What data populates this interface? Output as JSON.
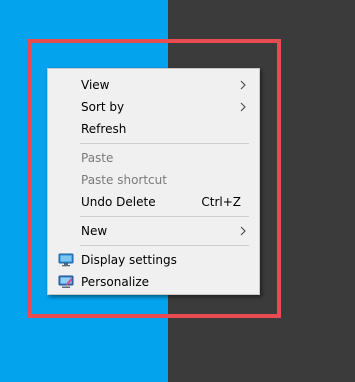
{
  "colors": {
    "desktop_left": "#04a3ee",
    "desktop_right": "#3b3b3b",
    "highlight_border": "#e84c50"
  },
  "menu": {
    "view_label": "View",
    "sort_by_label": "Sort by",
    "refresh_label": "Refresh",
    "paste_label": "Paste",
    "paste_shortcut_label": "Paste shortcut",
    "undo_delete_label": "Undo Delete",
    "undo_delete_shortcut": "Ctrl+Z",
    "new_label": "New",
    "display_settings_label": "Display settings",
    "personalize_label": "Personalize"
  },
  "icons": {
    "submenu": "chevron-right-icon",
    "display_settings": "display-settings-icon",
    "personalize": "personalize-icon"
  }
}
